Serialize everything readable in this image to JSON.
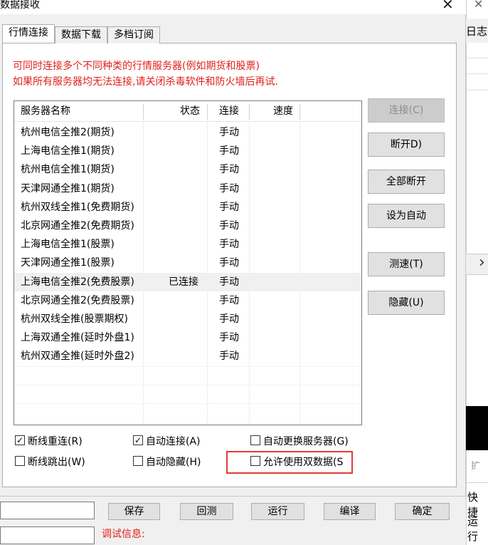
{
  "dialog": {
    "title": "数据接收",
    "close_glyph": "✕"
  },
  "tabs": [
    "行情连接",
    "数据下载",
    "多档订阅"
  ],
  "warnings": [
    "可同时连接多个不同种类的行情服务器(例如期货和股票)",
    "如果所有服务器均无法连接,请关闭杀毒软件和防火墙后再试."
  ],
  "table": {
    "columns": [
      "服务器名称",
      "状态",
      "连接",
      "速度"
    ],
    "rows": [
      {
        "name": "杭州电信全推2(期货)",
        "status": "",
        "conn": "手动",
        "speed": ""
      },
      {
        "name": "上海电信全推1(期货)",
        "status": "",
        "conn": "手动",
        "speed": ""
      },
      {
        "name": "杭州电信全推1(期货)",
        "status": "",
        "conn": "手动",
        "speed": ""
      },
      {
        "name": "天津网通全推1(期货)",
        "status": "",
        "conn": "手动",
        "speed": ""
      },
      {
        "name": "杭州双线全推1(免费期货)",
        "status": "",
        "conn": "手动",
        "speed": ""
      },
      {
        "name": "北京网通全推2(免费期货)",
        "status": "",
        "conn": "手动",
        "speed": ""
      },
      {
        "name": "上海电信全推1(股票)",
        "status": "",
        "conn": "手动",
        "speed": ""
      },
      {
        "name": "天津网通全推1(股票)",
        "status": "",
        "conn": "手动",
        "speed": ""
      },
      {
        "name": "上海电信全推2(免费股票)",
        "status": "已连接",
        "conn": "手动",
        "speed": ""
      },
      {
        "name": "北京网通全推2(免费股票)",
        "status": "",
        "conn": "手动",
        "speed": ""
      },
      {
        "name": "杭州双线全推(股票期权)",
        "status": "",
        "conn": "手动",
        "speed": ""
      },
      {
        "name": "上海双通全推(延时外盘1)",
        "status": "",
        "conn": "手动",
        "speed": ""
      },
      {
        "name": "杭州双通全推(延时外盘2)",
        "status": "",
        "conn": "手动",
        "speed": ""
      }
    ]
  },
  "side_buttons": {
    "connect": "连接(C)",
    "disconnect": "断开D)",
    "disconnect_all": "全部断开",
    "set_auto": "设为自动",
    "speed_test": "测速(T)",
    "hide": "隐藏(U)"
  },
  "checkboxes": {
    "reconnect": {
      "label": "断线重连(R)",
      "checked": true
    },
    "auto_connect": {
      "label": "自动连接(A)",
      "checked": true
    },
    "auto_switch": {
      "label": "自动更换服务器(G)",
      "checked": false
    },
    "jump_out": {
      "label": "断线跳出(W)",
      "checked": false
    },
    "auto_hide": {
      "label": "自动隐藏(H)",
      "checked": false
    },
    "dual_data": {
      "label": "允许使用双数据(S",
      "checked": false
    }
  },
  "check_glyph": "✓",
  "bottom": {
    "buttons": [
      "保存",
      "回测",
      "运行",
      "编译",
      "确定"
    ],
    "debug_label": "调试信息:"
  },
  "background": {
    "close_glyph": "✕",
    "log_label": "日志",
    "arrow_glyph": "›",
    "expand_label": "扩",
    "shortcut_label": "快捷",
    "run_label": "运行"
  }
}
